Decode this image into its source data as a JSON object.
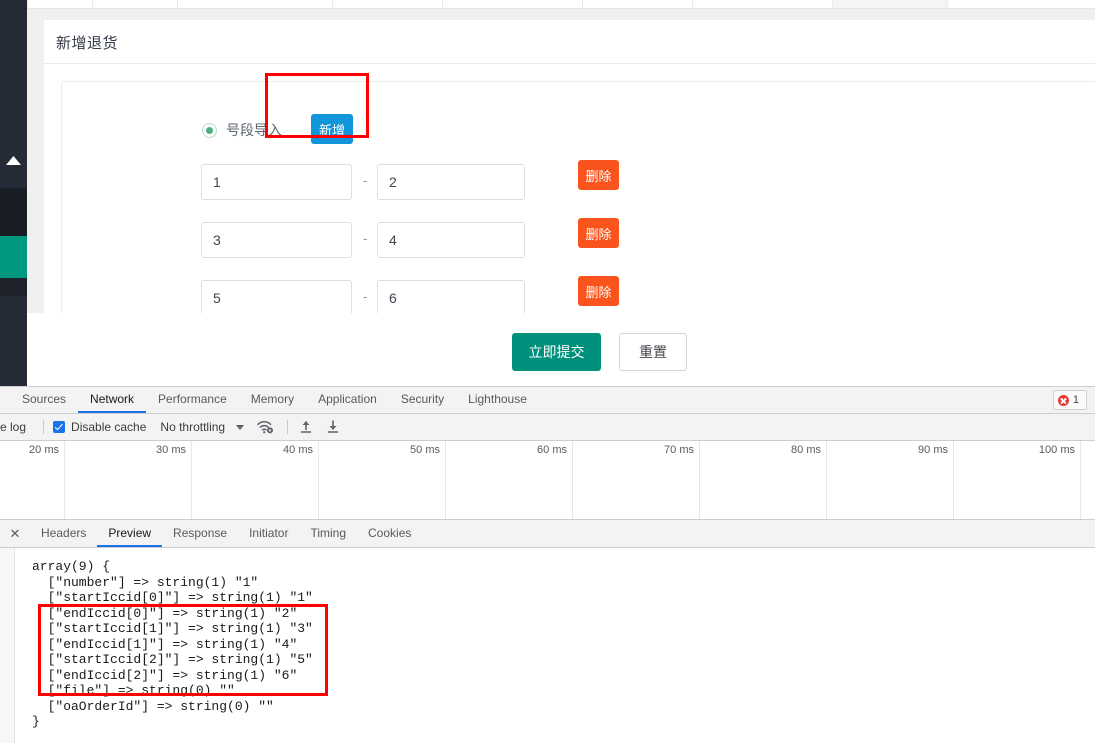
{
  "app": {
    "sidebar": {
      "collapse_icon": "triangle-up-icon",
      "accent_color": "#00997f",
      "background_color": "#252b36"
    }
  },
  "form_page": {
    "title": "新增退货",
    "import_mode": {
      "radio_label": "号段导入",
      "selected": true,
      "radio_color": "#4caf7d"
    },
    "add_button": {
      "label": "新增",
      "color": "#1296db"
    },
    "delete_button_color": "#fa541c",
    "range_separator": "-",
    "ranges": [
      {
        "start": "1",
        "end": "2",
        "delete_label": "删除"
      },
      {
        "start": "3",
        "end": "4",
        "delete_label": "删除"
      },
      {
        "start": "5",
        "end": "6",
        "delete_label": "删除"
      }
    ],
    "input_placeholder": "",
    "actions": {
      "submit_label": "立即提交",
      "submit_color": "#00917c",
      "reset_label": "重置"
    }
  },
  "devtools": {
    "panels": [
      {
        "label": "Sources",
        "active": false,
        "clipped": false
      },
      {
        "label": "Network",
        "active": true,
        "clipped": false
      },
      {
        "label": "Performance",
        "active": false,
        "clipped": false
      },
      {
        "label": "Memory",
        "active": false,
        "clipped": false
      },
      {
        "label": "Application",
        "active": false,
        "clipped": false
      },
      {
        "label": "Security",
        "active": false,
        "clipped": false
      },
      {
        "label": "Lighthouse",
        "active": false,
        "clipped": false
      }
    ],
    "error_badge": {
      "count": "1",
      "color": "#e53935"
    },
    "network_toolbar": {
      "preserve_log_clipped": "e log",
      "disable_cache_label": "Disable cache",
      "disable_cache_checked": true,
      "throttling_value": "No throttling",
      "throttling_caret": "chevron-down-icon",
      "wifi_icon": "wifi-settings-icon",
      "import_icon": "upload-arrow-icon",
      "export_icon": "download-arrow-icon"
    },
    "overview_ruler": {
      "ticks": [
        "20 ms",
        "30 ms",
        "40 ms",
        "50 ms",
        "60 ms",
        "70 ms",
        "80 ms",
        "90 ms",
        "100 ms"
      ]
    },
    "request_tabs": {
      "close_icon": "close-icon",
      "tabs": [
        {
          "label": "Headers",
          "active": false
        },
        {
          "label": "Preview",
          "active": true
        },
        {
          "label": "Response",
          "active": false
        },
        {
          "label": "Initiator",
          "active": false
        },
        {
          "label": "Timing",
          "active": false
        },
        {
          "label": "Cookies",
          "active": false
        }
      ]
    },
    "preview_body": {
      "dump": "array(9) {\n  [\"number\"] => string(1) \"1\"\n  [\"startIccid[0]\"] => string(1) \"1\"\n  [\"endIccid[0]\"] => string(1) \"2\"\n  [\"startIccid[1]\"] => string(1) \"3\"\n  [\"endIccid[1]\"] => string(1) \"4\"\n  [\"startIccid[2]\"] => string(1) \"5\"\n  [\"endIccid[2]\"] => string(1) \"6\"\n  [\"file\"] => string(0) \"\"\n  [\"oaOrderId\"] => string(0) \"\"\n}"
    }
  },
  "annotations": {
    "color": "#ff0000",
    "boxes": [
      {
        "name": "add-button-highlight"
      },
      {
        "name": "iccid-params-highlight"
      }
    ]
  }
}
